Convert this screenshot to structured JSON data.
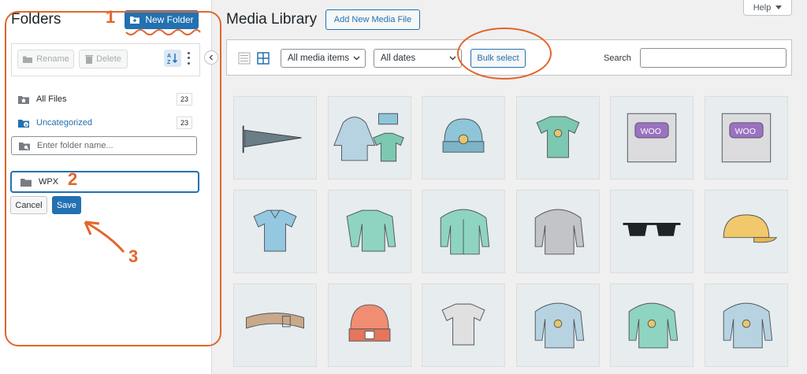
{
  "sidebar": {
    "title": "Folders",
    "new_folder_label": "New Folder",
    "rename_label": "Rename",
    "delete_label": "Delete",
    "folders": [
      {
        "label": "All Files",
        "count": "23"
      },
      {
        "label": "Uncategorized",
        "count": "23"
      }
    ],
    "folder_name_placeholder": "Enter folder name...",
    "new_folder_value": "WPX",
    "cancel_label": "Cancel",
    "save_label": "Save"
  },
  "main": {
    "title": "Media Library",
    "add_new_label": "Add New Media File",
    "help_label": "Help",
    "filters": {
      "media_type": "All media items",
      "dates": "All dates"
    },
    "bulk_select_label": "Bulk select",
    "search_label": "Search",
    "search_value": ""
  },
  "media_items": [
    {
      "icon": "pennant-icon"
    },
    {
      "icon": "hoodie-set-icon"
    },
    {
      "icon": "beanie-icon"
    },
    {
      "icon": "tshirt-icon"
    },
    {
      "icon": "woo-single-icon"
    },
    {
      "icon": "woo-album-icon"
    },
    {
      "icon": "polo-icon"
    },
    {
      "icon": "long-sleeve-icon"
    },
    {
      "icon": "hoodie-zip-icon"
    },
    {
      "icon": "hoodie-gray-icon"
    },
    {
      "icon": "sunglasses-icon"
    },
    {
      "icon": "cap-icon"
    },
    {
      "icon": "belt-icon"
    },
    {
      "icon": "beanie-orange-icon"
    },
    {
      "icon": "tshirt-gray-icon"
    },
    {
      "icon": "hoodie-logo-icon"
    },
    {
      "icon": "hoodie-green-icon"
    },
    {
      "icon": "hoodie-blue-icon"
    }
  ],
  "annotations": [
    "1",
    "2",
    "3"
  ],
  "colors": {
    "accent": "#2271b1",
    "annotation": "#e3652b"
  }
}
